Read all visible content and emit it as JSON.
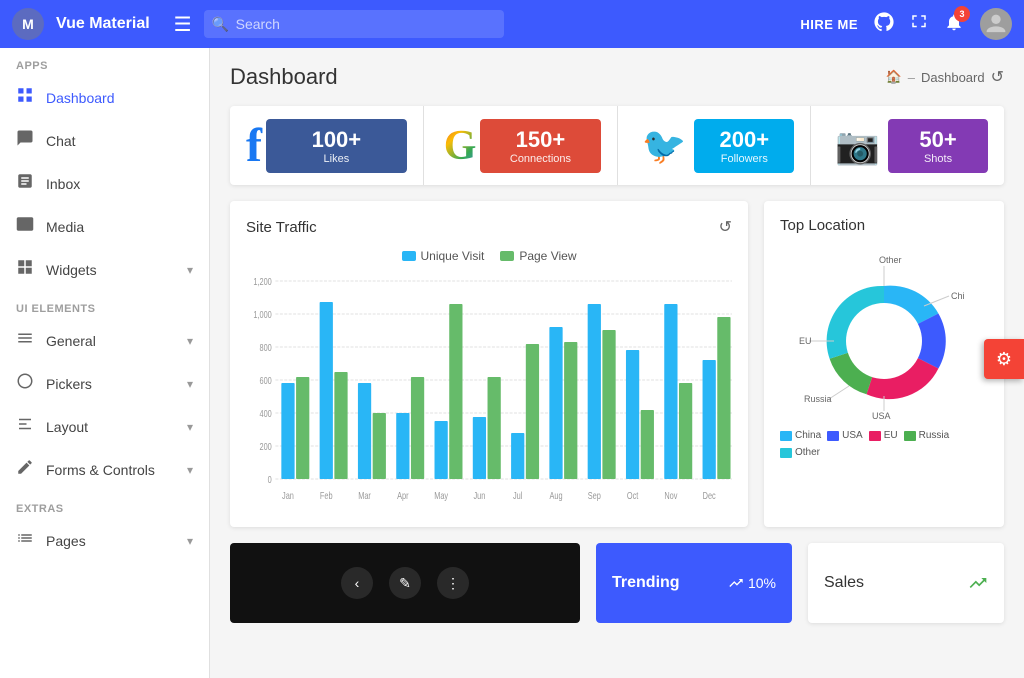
{
  "header": {
    "logo_initials": "M",
    "title": "Vue Material",
    "menu_icon": "☰",
    "search_placeholder": "Search",
    "hire_me_label": "HIRE ME",
    "notification_count": "3"
  },
  "sidebar": {
    "apps_label": "Apps",
    "ui_elements_label": "UI Elements",
    "extras_label": "Extras",
    "items_apps": [
      {
        "id": "dashboard",
        "label": "Dashboard",
        "active": true
      },
      {
        "id": "chat",
        "label": "Chat"
      },
      {
        "id": "inbox",
        "label": "Inbox"
      },
      {
        "id": "media",
        "label": "Media"
      },
      {
        "id": "widgets",
        "label": "Widgets"
      }
    ],
    "items_ui": [
      {
        "id": "general",
        "label": "General",
        "has_arrow": true
      },
      {
        "id": "pickers",
        "label": "Pickers",
        "has_arrow": true
      },
      {
        "id": "layout",
        "label": "Layout",
        "has_arrow": true
      },
      {
        "id": "forms",
        "label": "Forms & Controls",
        "has_arrow": true
      }
    ],
    "items_extras": [
      {
        "id": "pages",
        "label": "Pages",
        "has_arrow": true
      }
    ]
  },
  "breadcrumb": {
    "page_title": "Dashboard",
    "home_icon": "🏠",
    "separator": "–",
    "current": "Dashboard"
  },
  "social_cards": [
    {
      "id": "facebook",
      "logo": "f",
      "logo_color": "#1877f2",
      "count": "100+",
      "label": "Likes",
      "bg": "#3b5998"
    },
    {
      "id": "google",
      "logo": "G",
      "logo_color": "#ea4335",
      "count": "150+",
      "label": "Connections",
      "bg": "#dd4b39"
    },
    {
      "id": "twitter",
      "logo": "🐦",
      "logo_color": "#1da1f2",
      "count": "200+",
      "label": "Followers",
      "bg": "#00aced"
    },
    {
      "id": "instagram",
      "logo": "📷",
      "logo_color": "#e1306c",
      "count": "50+",
      "label": "Shots",
      "bg": "#833ab4"
    }
  ],
  "site_traffic": {
    "title": "Site Traffic",
    "legend": [
      {
        "label": "Unique Visit",
        "color": "#29b6f6"
      },
      {
        "label": "Page View",
        "color": "#66bb6a"
      }
    ],
    "y_labels": [
      "1,200",
      "1,000",
      "800",
      "600",
      "400",
      "200",
      "0"
    ],
    "x_labels": [
      "Jan",
      "Feb",
      "Mar",
      "Apr",
      "May",
      "Jun",
      "Jul",
      "Aug",
      "Sep",
      "Oct",
      "Nov",
      "Dec"
    ],
    "data": [
      {
        "month": "Jan",
        "unique": 58,
        "page": 62
      },
      {
        "month": "Feb",
        "unique": 105,
        "page": 65
      },
      {
        "month": "Mar",
        "unique": 58,
        "page": 40
      },
      {
        "month": "Apr",
        "unique": 42,
        "page": 62
      },
      {
        "month": "May",
        "unique": 35,
        "page": 105
      },
      {
        "month": "Jun",
        "unique": 38,
        "page": 62
      },
      {
        "month": "Jul",
        "unique": 28,
        "page": 82
      },
      {
        "month": "Aug",
        "unique": 92,
        "page": 82
      },
      {
        "month": "Sep",
        "unique": 105,
        "page": 90
      },
      {
        "month": "Oct",
        "unique": 78,
        "page": 42
      },
      {
        "month": "Nov",
        "unique": 105,
        "page": 58
      },
      {
        "month": "Dec",
        "unique": 72,
        "page": 98
      }
    ]
  },
  "top_location": {
    "title": "Top Location",
    "segments": [
      {
        "label": "China",
        "color": "#29b6f6",
        "value": 35
      },
      {
        "label": "USA",
        "color": "#3d5afe",
        "value": 20
      },
      {
        "label": "EU",
        "color": "#e91e63",
        "value": 18
      },
      {
        "label": "Russia",
        "color": "#4caf50",
        "value": 15
      },
      {
        "label": "Other",
        "color": "#26c6da",
        "value": 12
      }
    ]
  },
  "bottom": {
    "trending_label": "Trending",
    "trending_pct": "10%",
    "sales_label": "Sales"
  },
  "fab": {
    "icon": "⚙"
  }
}
